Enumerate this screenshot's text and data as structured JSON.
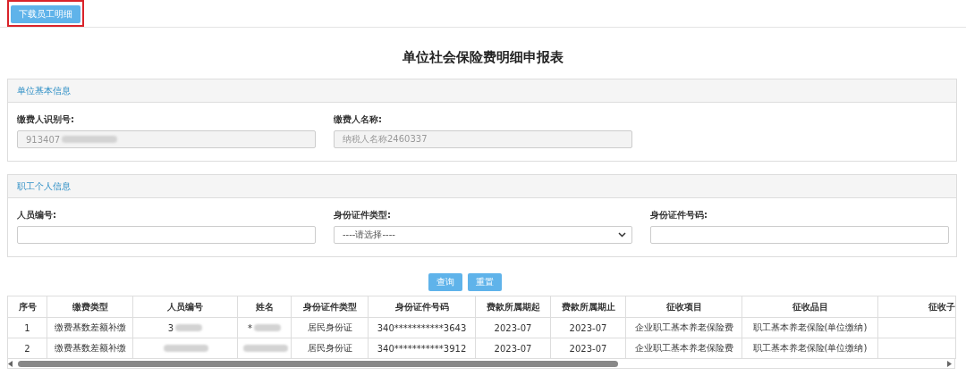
{
  "toolbar": {
    "download_button": {
      "label": "下载员工明细",
      "highlighted": true
    }
  },
  "title": "单位社会保险费明细申报表",
  "panels": [
    {
      "heading": "单位基本信息",
      "fields": [
        {
          "kind": "input",
          "label": "缴费人识别号:",
          "value": "913407",
          "redacted": true,
          "disabled": true
        },
        {
          "kind": "input",
          "label": "缴费人名称:",
          "value": "纳税人名称2460337",
          "disabled": true
        }
      ]
    },
    {
      "heading": "职工个人信息",
      "fields": [
        {
          "kind": "input",
          "label": "人员编号:"
        },
        {
          "kind": "select",
          "label": "身份证件类型:",
          "value": "----请选择----"
        },
        {
          "kind": "input",
          "label": "身份证件号码:"
        }
      ]
    }
  ],
  "actions": [
    "查询",
    "重置"
  ],
  "table": {
    "columns": [
      "序号",
      "缴费类型",
      "人员编号",
      "姓名",
      "身份证件类型",
      "身份证件号码",
      "费款所属期起",
      "费款所属期止",
      "征收项目",
      "征收品目",
      "征收子"
    ],
    "rows": [
      [
        {
          "text": "1"
        },
        {
          "text": "缴费基数差额补缴"
        },
        {
          "text": "3",
          "redacted": true
        },
        {
          "text": "*",
          "redacted": true
        },
        {
          "text": "居民身份证"
        },
        {
          "text": "340***********3643"
        },
        {
          "text": "2023-07"
        },
        {
          "text": "2023-07"
        },
        {
          "text": "企业职工基本养老保险费"
        },
        {
          "text": "职工基本养老保险(单位缴纳)"
        },
        {}
      ],
      [
        {
          "text": "2"
        },
        {
          "text": "缴费基数差额补缴"
        },
        {
          "redacted": true
        },
        {
          "redacted": true
        },
        {
          "text": "居民身份证"
        },
        {
          "text": "340***********3912"
        },
        {
          "text": "2023-07"
        },
        {
          "text": "2023-07"
        },
        {
          "text": "企业职工基本养老保险费"
        },
        {
          "text": "职工基本养老保险(单位缴纳)"
        },
        {}
      ]
    ]
  }
}
